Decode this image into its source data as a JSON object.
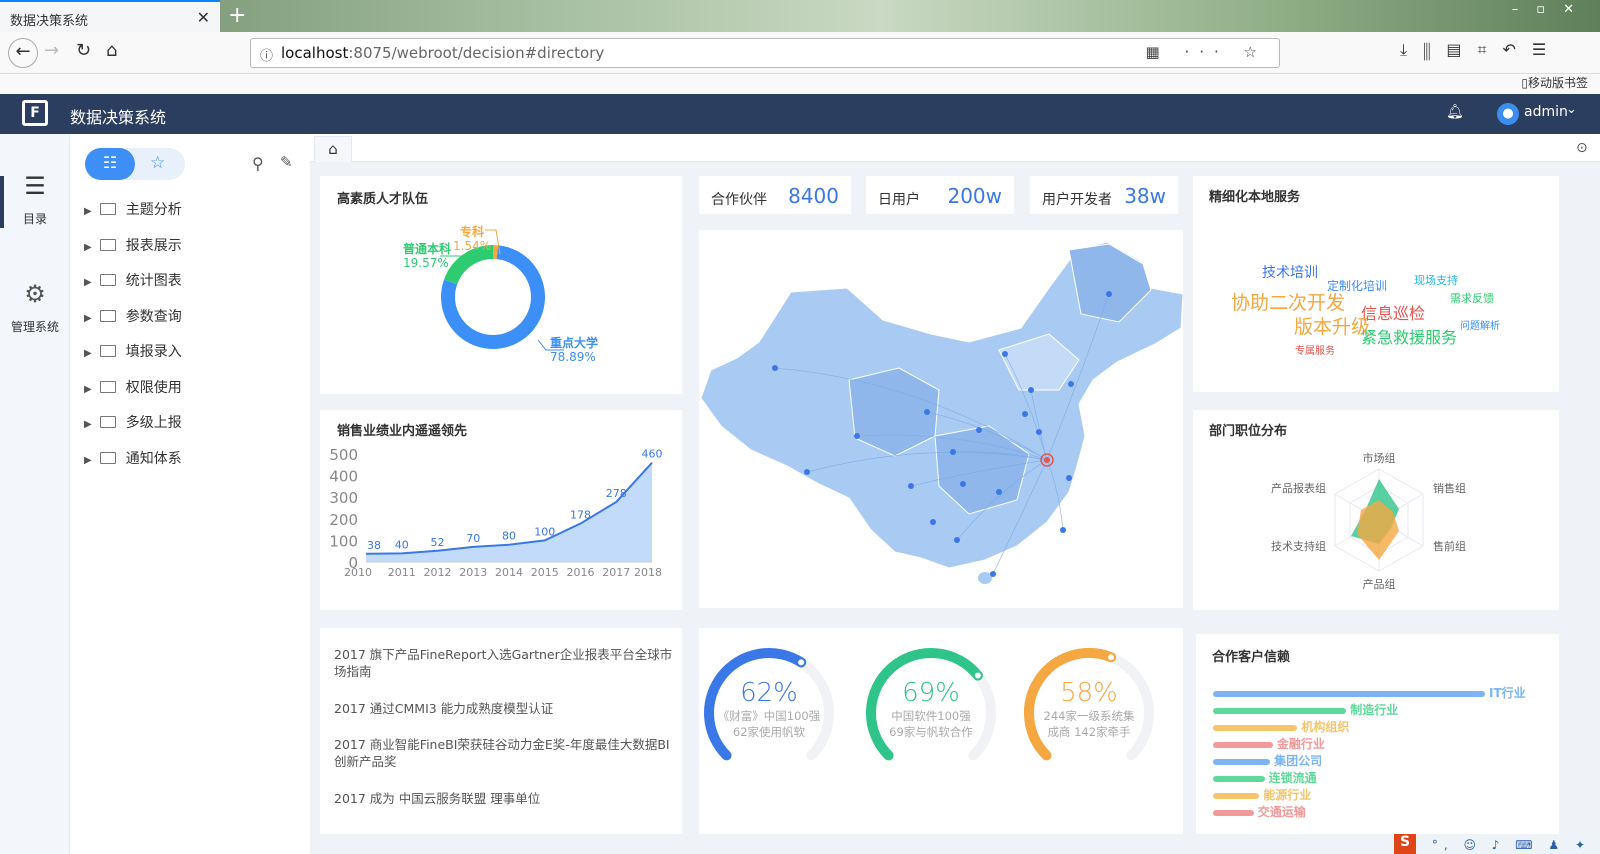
{
  "browser": {
    "tab_title": "数据决策系统",
    "url_host": "localhost",
    "url_rest": ":8075/webroot/decision#directory",
    "bookmark_label": "移动版书签"
  },
  "app": {
    "title": "数据决策系统",
    "user": "admin"
  },
  "rail": {
    "items": [
      {
        "label": "目录",
        "icon": "list-icon"
      },
      {
        "label": "管理系统",
        "icon": "gear-icon"
      }
    ]
  },
  "tree": {
    "items": [
      "主题分析",
      "报表展示",
      "统计图表",
      "参数查询",
      "填报录入",
      "权限使用",
      "多级上报",
      "通知体系"
    ]
  },
  "dashboard": {
    "talent": {
      "title": "高素质人才队伍",
      "slices": [
        {
          "label": "专科",
          "pct": "1.54%",
          "value": 1.54,
          "color": "#f5a742"
        },
        {
          "label": "普通本科",
          "pct": "19.57%",
          "value": 19.57,
          "color": "#2ecc71"
        },
        {
          "label": "重点大学",
          "pct": "78.89%",
          "value": 78.89,
          "color": "#3b8ff7"
        }
      ]
    },
    "kpis": [
      {
        "label": "合作伙伴",
        "value": "8400"
      },
      {
        "label": "日用户",
        "value": "200w"
      },
      {
        "label": "用户开发者",
        "value": "38w"
      }
    ],
    "service": {
      "title": "精细化本地服务",
      "words": [
        {
          "text": "技术培训",
          "color": "#3b78e7",
          "size": 14
        },
        {
          "text": "定制化培训",
          "color": "#3b8ff7",
          "size": 12
        },
        {
          "text": "现场支持",
          "color": "#1fb5e8",
          "size": 11
        },
        {
          "text": "协助二次开发",
          "color": "#f5a742",
          "size": 19
        },
        {
          "text": "信息巡检",
          "color": "#e8544e",
          "size": 16
        },
        {
          "text": "需求反馈",
          "color": "#2ecc71",
          "size": 11
        },
        {
          "text": "版本升级",
          "color": "#f5a742",
          "size": 19
        },
        {
          "text": "紧急救援服务",
          "color": "#2ecc71",
          "size": 16
        },
        {
          "text": "问题解析",
          "color": "#3b8ff7",
          "size": 10
        },
        {
          "text": "专属服务",
          "color": "#e8544e",
          "size": 10
        }
      ]
    },
    "sales": {
      "title": "销售业绩业内遥遥领先"
    },
    "dept": {
      "title": "部门职位分布",
      "axes": [
        "市场组",
        "销售组",
        "售前组",
        "产品组",
        "技术支持组",
        "产品报表组"
      ]
    },
    "news": [
      "2017 旗下产品FineReport入选Gartner企业报表平台全球市场指南",
      "2017 通过CMMI3 能力成熟度模型认证",
      "2017 商业智能FineBI荣获硅谷动力金E奖-年度最佳大数据BI创新产品奖",
      "2017 成为 中国云服务联盟 理事单位"
    ],
    "gauges": [
      {
        "pct": "62%",
        "value": 62,
        "color": "#3b78e7",
        "line1": "《财富》中国100强",
        "line2": "62家使用帆软"
      },
      {
        "pct": "69%",
        "value": 69,
        "color": "#2ec48a",
        "line1": "中国软件100强",
        "line2": "69家与帆软合作"
      },
      {
        "pct": "58%",
        "value": 58,
        "color": "#f5a742",
        "line1": "244家一级系统集",
        "line2": "成商 142家牵手"
      }
    ],
    "clients": {
      "title": "合作客户信赖",
      "rows": [
        {
          "label": "IT行业",
          "value": 100,
          "color": "#7cb4f5"
        },
        {
          "label": "制造行业",
          "value": 49,
          "color": "#5fd99a"
        },
        {
          "label": "机构组织",
          "value": 31,
          "color": "#f7c46a"
        },
        {
          "label": "金融行业",
          "value": 22,
          "color": "#f29a9a"
        },
        {
          "label": "集团公司",
          "value": 21,
          "color": "#7cb4f5"
        },
        {
          "label": "连锁流通",
          "value": 19,
          "color": "#5fd99a"
        },
        {
          "label": "能源行业",
          "value": 17,
          "color": "#f7c46a"
        },
        {
          "label": "交通运输",
          "value": 15,
          "color": "#f29a9a"
        }
      ]
    }
  },
  "chart_data": [
    {
      "type": "area",
      "title": "销售业绩业内遥遥领先",
      "x": [
        "2010",
        "2011",
        "2012",
        "2013",
        "2014",
        "2015",
        "2016",
        "2017",
        "2018"
      ],
      "values": [
        38,
        40,
        52,
        70,
        80,
        100,
        178,
        278,
        460
      ],
      "ylim": [
        0,
        500
      ],
      "yticks": [
        0,
        100,
        200,
        300,
        400,
        500
      ]
    },
    {
      "type": "pie",
      "title": "高素质人才队伍",
      "labels": [
        "专科",
        "普通本科",
        "重点大学"
      ],
      "values": [
        1.54,
        19.57,
        78.89
      ]
    }
  ]
}
